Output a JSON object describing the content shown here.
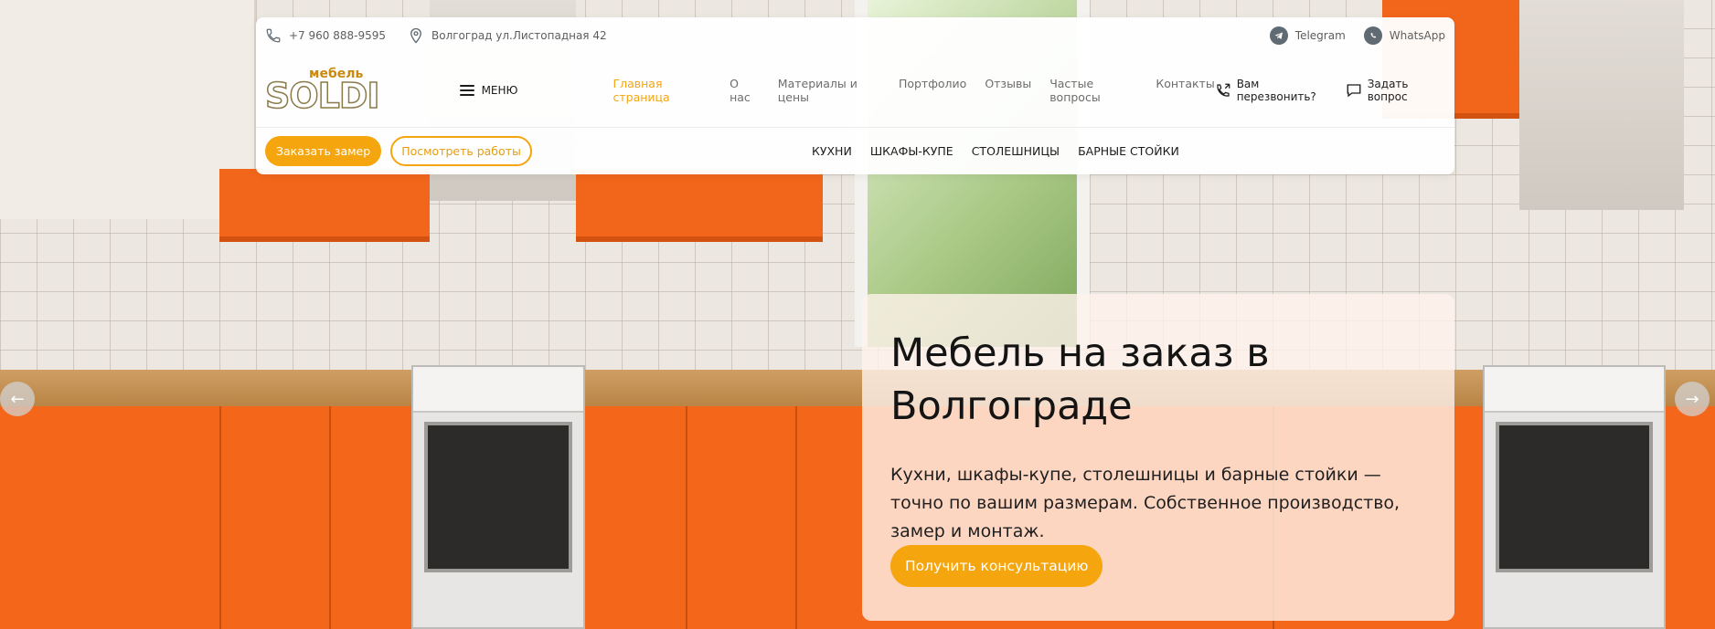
{
  "topbar": {
    "phone": "+7 960 888-9595",
    "address": "Волгоград ул.Листопадная 42",
    "telegram": "Telegram",
    "whatsapp": "WhatsApp"
  },
  "logo": {
    "small": "мебель",
    "big": "SOLDI"
  },
  "menu_label": "МЕНЮ",
  "nav": [
    {
      "label": "Главная страница",
      "active": true
    },
    {
      "label": "О нас"
    },
    {
      "label": "Материалы и цены"
    },
    {
      "label": "Портфолио"
    },
    {
      "label": "Отзывы"
    },
    {
      "label": "Частые вопросы"
    },
    {
      "label": "Контакты"
    }
  ],
  "actions": {
    "callback": "Вам перезвонить?",
    "ask": "Задать вопрос"
  },
  "buttons": {
    "order": "Заказать замер",
    "works": "Посмотреть работы"
  },
  "categories": [
    "КУХНИ",
    "ШКАФЫ-КУПЕ",
    "СТОЛЕШНИЦЫ",
    "БАРНЫЕ СТОЙКИ"
  ],
  "hero": {
    "title": "Мебель на заказ в Волгограде",
    "text": "Кухни, шкафы-купе, столешницы и барные стойки — точно по вашим размерам. Собственное производство, замер и монтаж.",
    "cta": "Получить консультацию"
  },
  "slider": {
    "prev": "←",
    "next": "→"
  },
  "colors": {
    "accent": "#f5a50e",
    "cabinet": "#f2661b"
  }
}
